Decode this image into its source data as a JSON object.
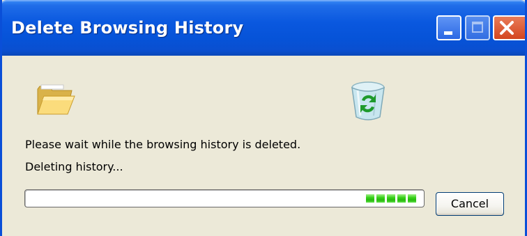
{
  "window": {
    "title": "Delete Browsing History"
  },
  "titlebar_buttons": {
    "minimize": "minimize-icon",
    "maximize": "maximize-icon",
    "close": "close-icon"
  },
  "icons": {
    "source": "folder-icon",
    "destination": "recycle-bin-icon"
  },
  "messages": {
    "line1": "Please wait while the browsing history is deleted.",
    "line2": "Deleting history..."
  },
  "progress": {
    "style": "marquee",
    "active_blocks": 5,
    "color": "#2ecc1c"
  },
  "actions": {
    "cancel_label": "Cancel"
  },
  "colors": {
    "titlebar": "#0a58df",
    "window_bg": "#ece9d8",
    "close_button": "#d9532d"
  }
}
